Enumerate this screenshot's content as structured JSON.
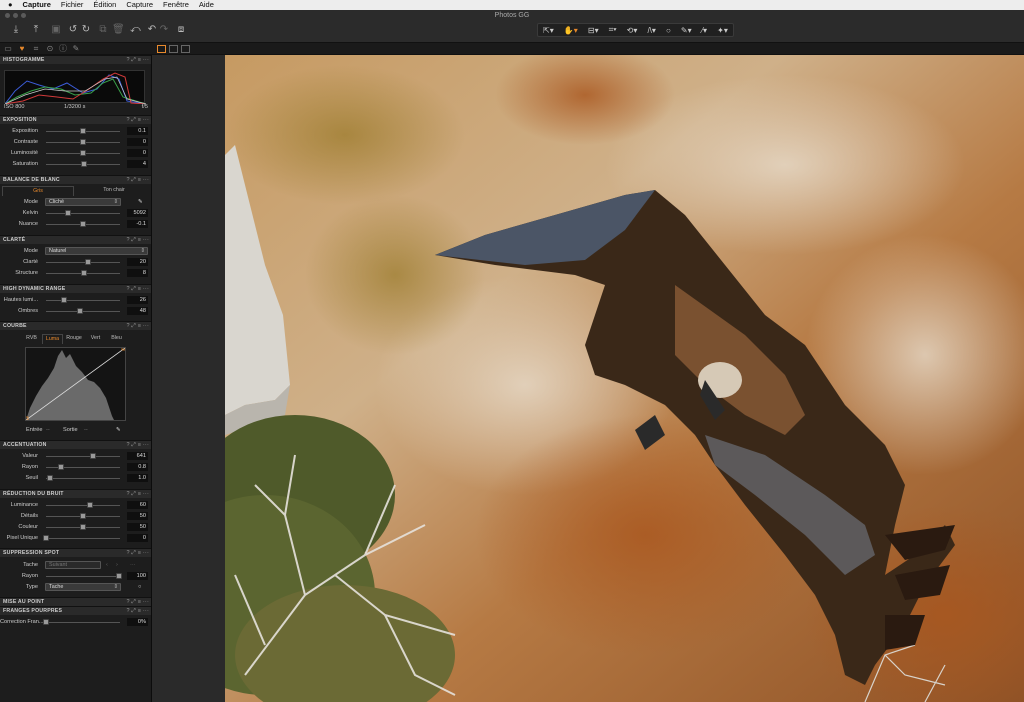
{
  "menubar": {
    "apple": "",
    "app": "Capture",
    "items": [
      "Fichier",
      "Édition",
      "Capture",
      "Fenêtre",
      "Aide"
    ]
  },
  "window": {
    "title": "Photos GG"
  },
  "toolbar": {
    "left_icons": [
      "import-icon",
      "export-icon",
      "camera-icon",
      "rotate-left-icon",
      "rotate-right-icon",
      "copy-icon",
      "trash-icon",
      "reset-icon",
      "undo-icon",
      "redo-icon",
      "stack-icon"
    ],
    "center_tools": [
      "cursor-tool-icon",
      "hand-tool-icon",
      "crop-frame-icon",
      "crop-icon",
      "rotate-tool-icon",
      "keystone-icon",
      "circle-icon",
      "color-picker-icon",
      "brush-icon",
      "wand-icon"
    ]
  },
  "tool_tabs": [
    "folder-icon",
    "color-icon",
    "crop-tab-icon",
    "details-icon",
    "info-icon",
    "adjust-icon"
  ],
  "histogram": {
    "title": "HISTOGRAMME",
    "iso": "ISO 800",
    "shutter": "1/3200 s",
    "aperture": "f/5"
  },
  "exposition": {
    "title": "EXPOSITION",
    "rows": [
      {
        "label": "Exposition",
        "value": "0.1",
        "pos": 0.5
      },
      {
        "label": "Contraste",
        "value": "0",
        "pos": 0.5
      },
      {
        "label": "Luminosité",
        "value": "0",
        "pos": 0.5
      },
      {
        "label": "Saturation",
        "value": "4",
        "pos": 0.52
      }
    ]
  },
  "white_balance": {
    "title": "BALANCE DE BLANC",
    "tabs": [
      "Gris",
      "Ton chair"
    ],
    "mode_label": "Mode",
    "mode_value": "Cliché",
    "rows": [
      {
        "label": "Kelvin",
        "value": "5092",
        "pos": 0.3
      },
      {
        "label": "Nuance",
        "value": "-0.1",
        "pos": 0.5
      }
    ]
  },
  "clarity": {
    "title": "CLARTÉ",
    "mode_label": "Mode",
    "mode_value": "Naturel",
    "rows": [
      {
        "label": "Clarté",
        "value": "20",
        "pos": 0.57
      },
      {
        "label": "Structure",
        "value": "8",
        "pos": 0.52
      }
    ]
  },
  "hdr": {
    "title": "HIGH DYNAMIC RANGE",
    "rows": [
      {
        "label": "Hautes lumi...",
        "value": "26",
        "pos": 0.24
      },
      {
        "label": "Ombres",
        "value": "48",
        "pos": 0.46
      }
    ]
  },
  "curve": {
    "title": "COURBE",
    "tabs": [
      "RVB",
      "Luma",
      "Rouge",
      "Vert",
      "Bleu"
    ],
    "entry_label": "Entrée",
    "entry_value": "--",
    "exit_label": "Sortie",
    "exit_value": "--"
  },
  "sharpening": {
    "title": "ACCENTUATION",
    "rows": [
      {
        "label": "Valeur",
        "value": "641",
        "pos": 0.64
      },
      {
        "label": "Rayon",
        "value": "0.8",
        "pos": 0.2
      },
      {
        "label": "Seuil",
        "value": "1.0",
        "pos": 0.05
      }
    ]
  },
  "noise": {
    "title": "RÉDUCTION DU BRUIT",
    "rows": [
      {
        "label": "Luminance",
        "value": "60",
        "pos": 0.6
      },
      {
        "label": "Détails",
        "value": "50",
        "pos": 0.5
      },
      {
        "label": "Couleur",
        "value": "50",
        "pos": 0.5
      },
      {
        "label": "Pixel Unique",
        "value": "0",
        "pos": 0.0
      }
    ]
  },
  "spot": {
    "title": "SUPPRESSION SPOT",
    "tache_label": "Tache",
    "tache_value": "Suivant",
    "rayon_label": "Rayon",
    "rayon_value": "100",
    "rayon_pos": 0.98,
    "type_label": "Type",
    "type_value": "Tache"
  },
  "focus": {
    "title": "MISE AU POINT"
  },
  "fringe": {
    "title": "FRANGES POURPRES",
    "rows": [
      {
        "label": "Correction Fran...",
        "value": "0%",
        "pos": 0.0
      }
    ]
  },
  "section_icons": "? ⤢ ≡ ···"
}
